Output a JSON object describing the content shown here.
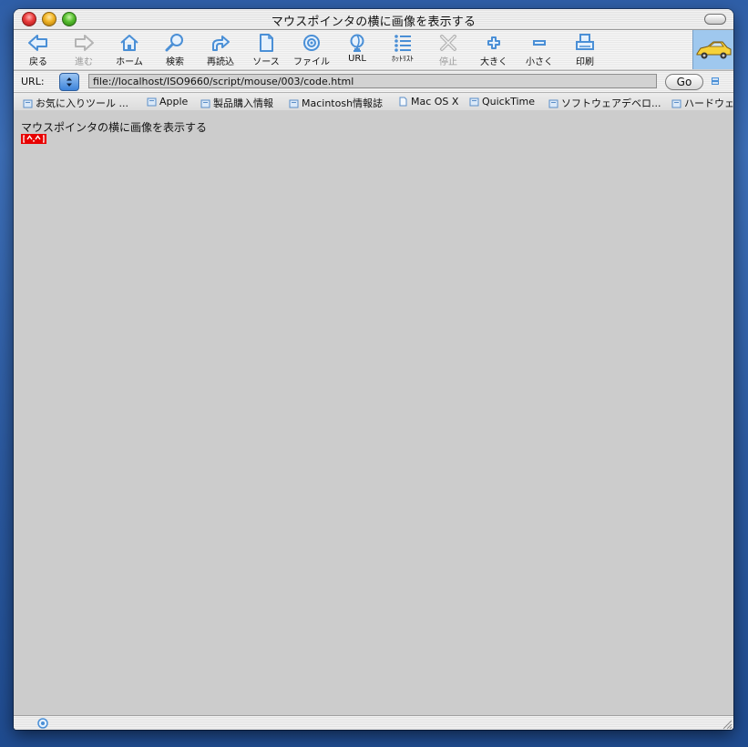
{
  "window": {
    "title": "マウスポインタの横に画像を表示する"
  },
  "toolbar": {
    "back": "戻る",
    "forward": "進む",
    "home": "ホーム",
    "search": "検索",
    "reload": "再読込",
    "source": "ソース",
    "file": "ファイル",
    "url": "URL",
    "hotlist": "ﾎｯﾄﾘｽﾄ",
    "stop": "停止",
    "bigger": "大きく",
    "smaller": "小さく",
    "print": "印刷"
  },
  "address": {
    "label": "URL:",
    "value": "file://localhost/ISO9660/script/mouse/003/code.html",
    "go": "Go"
  },
  "favorites": [
    "お気に入りツール ...",
    "Apple",
    "製品購入情報",
    "Macintosh情報誌",
    "Mac OS X",
    "QuickTime",
    "ソフトウェアデベロ...",
    "ハードウェ"
  ],
  "page": {
    "text": "マウスポインタの横に画像を表示する",
    "image_text": "^.^"
  },
  "colors": {
    "accent": "#4a8fd6",
    "pointer_image": "#e80000",
    "content_bg": "#cccccc"
  }
}
